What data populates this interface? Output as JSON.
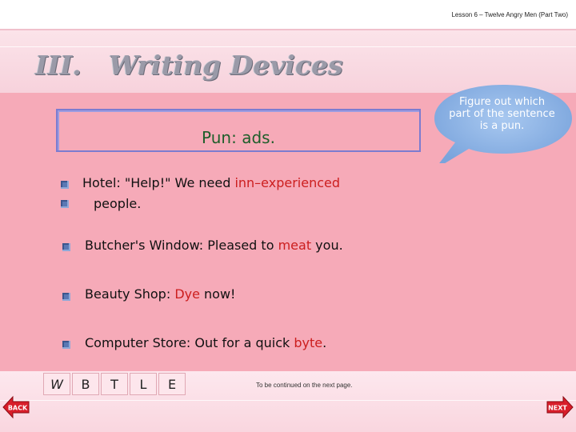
{
  "header": {
    "lesson": "Lesson 6 – Twelve Angry Men (Part Two)"
  },
  "section": {
    "numeral": "III.",
    "title": "Writing Devices"
  },
  "pun_box": {
    "text": "Pun: ads."
  },
  "bubble": {
    "text": "Figure out which part of the sentence is a pun."
  },
  "items": [
    {
      "before": "Hotel: \"Help!\" We need ",
      "highlight": "inn–experienced",
      "after": "",
      "line2": "people."
    },
    {
      "before": "Butcher's Window: Pleased to ",
      "highlight": "meat",
      "after": " you."
    },
    {
      "before": "Beauty Shop: ",
      "highlight": "Dye",
      "after": " now!"
    },
    {
      "before": "Computer Store: Out for a quick ",
      "highlight": "byte",
      "after": "."
    }
  ],
  "nav": {
    "buttons": [
      "W",
      "B",
      "T",
      "L",
      "E"
    ]
  },
  "footer": {
    "continued": "To be continued on the next page."
  },
  "arrows": {
    "back": "BACK",
    "next": "NEXT"
  },
  "colors": {
    "highlight": "#cc1e1e",
    "pun_text": "#1e5e2a",
    "main_band": "#f6aab8",
    "bubble": "#8ab2e6"
  }
}
